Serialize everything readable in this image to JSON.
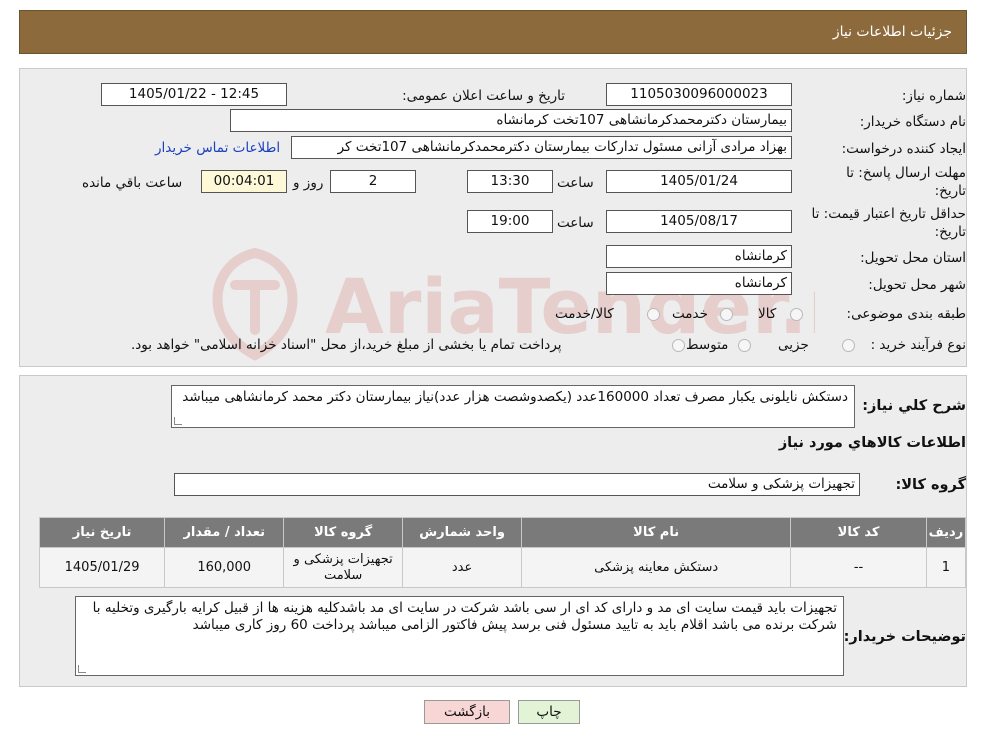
{
  "header": {
    "title": "جزئیات اطلاعات نیاز"
  },
  "form": {
    "need_number_label": "شماره نیاز:",
    "need_number": "1105030096000023",
    "announce_label": "تاریخ و ساعت اعلان عمومی:",
    "announce_value": "1405/01/22 - 12:45",
    "buyer_label": "نام دستگاه خریدار:",
    "buyer_value": "بیمارستان دکترمحمدکرمانشاهی 107تخت کرمانشاه",
    "creator_label": "ایجاد کننده درخواست:",
    "creator_value": "بهزاد مرادی آزانی مسئول تداركات بیمارستان دکترمحمدکرمانشاهی 107تخت کر",
    "contact_link": "اطلاعات تماس خریدار",
    "deadline_label_1": "مهلت ارسال پاسخ: تا",
    "deadline_label_2": "تاریخ:",
    "deadline_date": "1405/01/24",
    "time_label": "ساعت",
    "deadline_time": "13:30",
    "days_value": "2",
    "days_label": "روز و",
    "remaining_value": "00:04:01",
    "remaining_label": "ساعت باقي مانده",
    "validity_label_1": "حداقل تاریخ اعتبار قیمت: تا",
    "validity_label_2": "تاریخ:",
    "validity_date": "1405/08/17",
    "validity_time": "19:00",
    "province_label": "استان محل تحویل:",
    "province_value": "کرمانشاه",
    "city_label": "شهر محل تحویل:",
    "city_value": "کرمانشاه",
    "category_label": "طبقه بندی موضوعی:",
    "category_options": [
      "کالا",
      "خدمت",
      "کالا/خدمت"
    ],
    "process_label": "نوع فرآیند خرید :",
    "process_options": [
      "جزیی",
      "متوسط"
    ],
    "process_note": "پرداخت تمام یا بخشی از مبلغ خرید،از محل \"اسناد خزانه اسلامی\" خواهد بود."
  },
  "summary": {
    "label": "شرح کلي نياز:",
    "text": "دستکش نایلونی یکبار مصرف تعداد 160000عدد (یکصدوشصت هزار عدد)نیاز بیمارستان دکتر محمد کرمانشاهی میباشد",
    "goods_info_title": "اطلاعات کالاهاي مورد نياز",
    "group_label": "گروه کالا:",
    "group_value": "تجهیزات پزشکی و سلامت"
  },
  "table": {
    "headers": [
      "رديف",
      "کد کالا",
      "نام کالا",
      "واحد شمارش",
      "گروه کالا",
      "تعداد / مقدار",
      "تاریخ نیاز"
    ],
    "rows": [
      [
        "1",
        "--",
        "دستکش معاینه پزشکی",
        "عدد",
        "تجهیزات پزشکی و سلامت",
        "160,000",
        "1405/01/29"
      ]
    ]
  },
  "buyer_notes": {
    "label": "توضیحات خریدار:",
    "text": "تجهیزات باید قیمت سایت ای مد و دارای کد ای ار سی باشد شرکت در سایت ای مد باشدکلیه هزینه ها از قبیل کرایه بارگیری وتخلیه با شرکت برنده می باشد اقلام باید به تایید مسئول فنی برسد پیش فاکتور الزامی میباشد پرداخت 60 روز کاری میباشد"
  },
  "buttons": {
    "print": "چاپ",
    "back": "بازگشت"
  },
  "watermark": {
    "text": "AriaTender.neT"
  },
  "colors": {
    "header": "#8c6a3b",
    "link": "#1a3fbf",
    "back_button": "#f8d6d6",
    "print_button": "#e3f3d6"
  }
}
